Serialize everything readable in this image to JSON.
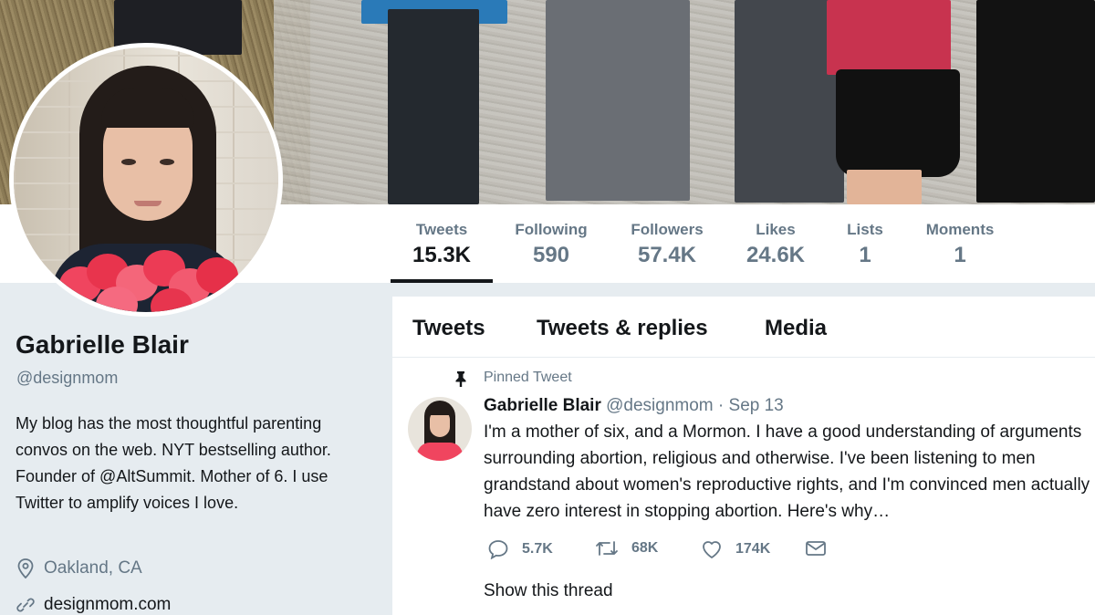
{
  "nav": {
    "stats": [
      {
        "label": "Tweets",
        "value": "15.3K",
        "active": true
      },
      {
        "label": "Following",
        "value": "590"
      },
      {
        "label": "Followers",
        "value": "57.4K"
      },
      {
        "label": "Likes",
        "value": "24.6K"
      },
      {
        "label": "Lists",
        "value": "1"
      },
      {
        "label": "Moments",
        "value": "1"
      }
    ]
  },
  "profile": {
    "name": "Gabrielle Blair",
    "handle": "@designmom",
    "bio": "My blog has the most thoughtful parenting convos on the web. NYT bestselling author. Founder of @AltSummit. Mother of 6. I use Twitter to amplify voices I love.",
    "location": "Oakland, CA",
    "website": "designmom.com"
  },
  "timeline": {
    "tabs": [
      "Tweets",
      "Tweets & replies",
      "Media"
    ],
    "pinned_label": "Pinned Tweet",
    "tweet": {
      "author": "Gabrielle Blair",
      "handle": "@designmom",
      "separator": "·",
      "date": "Sep 13",
      "text": "I'm a mother of six, and a Mormon. I have a good understanding of arguments\nsurrounding abortion, religious and otherwise. I've been listening to men\ngrandstand about women's reproductive rights, and I'm convinced men actually\nhave zero interest in stopping abortion. Here's why…",
      "replies": "5.7K",
      "retweets": "68K",
      "likes": "174K",
      "show_thread": "Show this thread"
    }
  },
  "icons": {
    "location": "map-pin-icon",
    "website": "link-icon",
    "pin": "pin-icon",
    "reply": "reply-icon",
    "retweet": "retweet-icon",
    "like": "heart-icon",
    "dm": "envelope-icon"
  },
  "colors": {
    "text": "#14171a",
    "muted": "#657786",
    "bg": "#e6ecf0"
  }
}
